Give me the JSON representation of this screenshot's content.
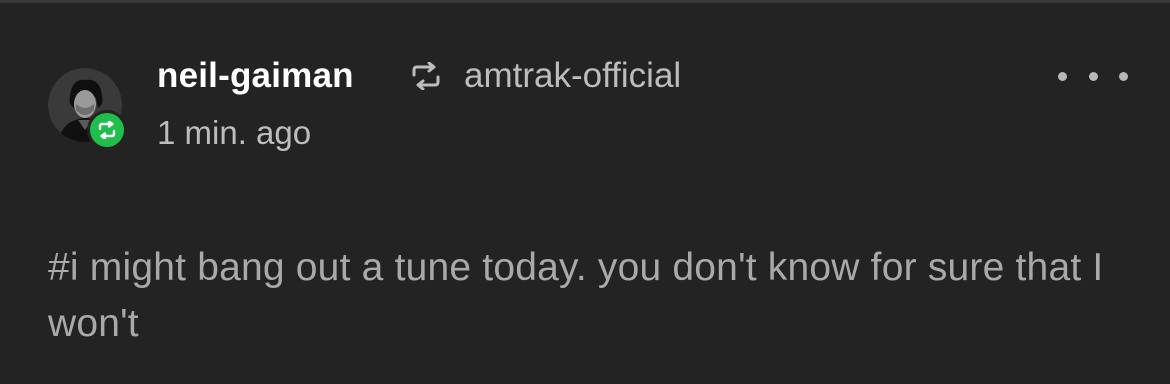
{
  "post": {
    "author": "neil-gaiman",
    "reblogged_from": "amtrak-official",
    "timestamp": "1 min. ago",
    "tags_text": "#i might bang out a tune today. you don't know for sure that I won't"
  },
  "icons": {
    "reblog": "reblog-icon",
    "more": "more-options-icon",
    "avatar_badge": "reblog-badge-icon"
  },
  "colors": {
    "background": "#232323",
    "reblog_badge": "#1fbf4b",
    "secondary_text": "#bdbdbd",
    "tag_text": "#a9a9a9"
  }
}
